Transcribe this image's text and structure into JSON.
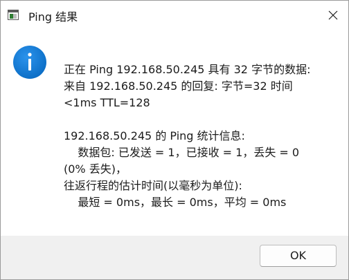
{
  "window": {
    "title": "Ping 结果"
  },
  "icons": {
    "app_icon": "console-window-icon",
    "close": "close-icon",
    "info": "info-icon",
    "info_color": "#0e7ad9"
  },
  "message": {
    "lines": [
      "正在 Ping 192.168.50.245 具有 32 字节的数据:",
      "来自 192.168.50.245 的回复: 字节=32 时间",
      "<1ms TTL=128",
      "",
      "192.168.50.245 的 Ping 统计信息:",
      "    数据包: 已发送 = 1，已接收 = 1，丢失 = 0",
      "(0% 丢失)，",
      "往返行程的估计时间(以毫秒为单位):",
      "    最短 = 0ms，最长 = 0ms，平均 = 0ms"
    ]
  },
  "footer": {
    "ok_label": "OK"
  }
}
